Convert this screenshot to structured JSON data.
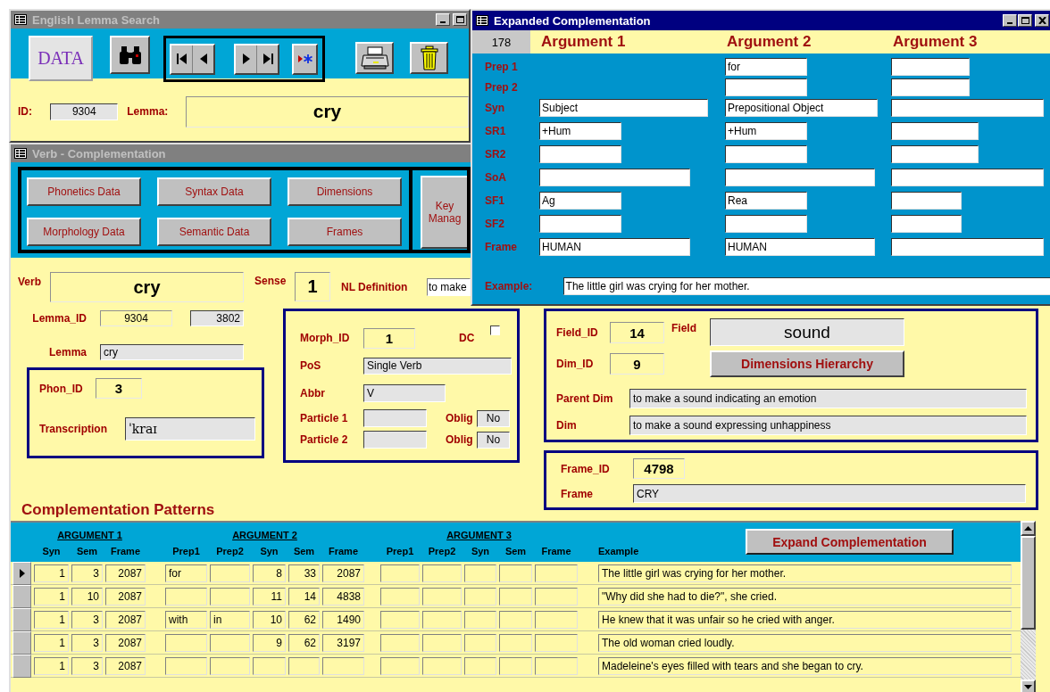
{
  "lemma_window": {
    "title": "English Lemma Search",
    "active": false,
    "data_button": "DATA",
    "id_label": "ID:",
    "id": "9304",
    "lemma_label": "Lemma:",
    "lemma": "cry"
  },
  "verb_window": {
    "title": "Verb - Complementation",
    "active": false,
    "buttons": [
      "Phonetics Data",
      "Syntax Data",
      "Dimensions",
      "Morphology Data",
      "Semantic Data",
      "Frames"
    ],
    "side_button": "Key Manag",
    "verb": {
      "label": "Verb",
      "value": "cry"
    },
    "sense": {
      "label": "Sense",
      "value": "1"
    },
    "nl_definition": {
      "label": "NL Definition",
      "value": "to make"
    },
    "lemma_id": {
      "label": "Lemma_ID",
      "value": "9304",
      "value_2": "3802"
    },
    "lemma": {
      "label": "Lemma",
      "value": "cry"
    },
    "phonetics": {
      "phon_id_label": "Phon_ID",
      "phon_id": "3",
      "transcription_label": "Transcription",
      "transcription": "ˈkraɪ"
    },
    "morphology": {
      "morph_id_label": "Morph_ID",
      "morph_id": "1",
      "dc_label": "DC",
      "dc": {
        "checked": false
      },
      "pos_label": "PoS",
      "pos": "Single Verb",
      "abbr_label": "Abbr",
      "abbr": "V",
      "particles": [
        {
          "label": "Particle 1",
          "oblig_label": "Oblig",
          "oblig": "No"
        },
        {
          "label": "Particle 2",
          "oblig_label": "Oblig",
          "oblig": "No"
        }
      ]
    },
    "dimensions": {
      "field_id_label": "Field_ID",
      "field_id": "14",
      "field_label": "Field",
      "field": "sound",
      "dim_id_label": "Dim_ID",
      "dim_id": "9",
      "hierarchy_button": "Dimensions Hierarchy",
      "parent_dim_label": "Parent Dim",
      "parent_dim": "to make a sound indicating an emotion",
      "dim_label": "Dim",
      "dim": "to make a sound expressing unhappiness"
    },
    "frame": {
      "frame_id_label": "Frame_ID",
      "frame_id": "4798",
      "frame_label": "Frame",
      "frame": "CRY"
    },
    "patterns": {
      "heading": "Complementation Patterns",
      "groups": [
        "ARGUMENT 1",
        "ARGUMENT 2",
        "ARGUMENT 3"
      ],
      "columns": [
        "Syn",
        "Sem",
        "Frame",
        "Prep1",
        "Prep2",
        "Syn",
        "Sem",
        "Frame",
        "Prep1",
        "Prep2",
        "Syn",
        "Sem",
        "Frame",
        "Example"
      ],
      "expand_button": "Expand Complementation",
      "rows": [
        {
          "selected": true,
          "arg1": {
            "syn": "1",
            "sem": "3",
            "frame": "2087"
          },
          "arg2": {
            "prep1": "for",
            "syn": "8",
            "sem": "33",
            "frame": "2087"
          },
          "example": "The little girl was crying for her mother."
        },
        {
          "selected": false,
          "arg1": {
            "syn": "1",
            "sem": "10",
            "frame": "2087"
          },
          "arg2": {
            "syn": "11",
            "sem": "14",
            "frame": "4838"
          },
          "example": "\"Why did she had to die?\", she cried."
        },
        {
          "selected": false,
          "arg1": {
            "syn": "1",
            "sem": "3",
            "frame": "2087"
          },
          "arg2": {
            "prep1": "with",
            "prep2": "in",
            "syn": "10",
            "sem": "62",
            "frame": "1490"
          },
          "example": "He knew that it was unfair so he cried with anger."
        },
        {
          "selected": false,
          "arg1": {
            "syn": "1",
            "sem": "3",
            "frame": "2087"
          },
          "arg2": {
            "syn": "9",
            "sem": "62",
            "frame": "3197"
          },
          "example": "The old woman cried loudly."
        },
        {
          "selected": false,
          "arg1": {
            "syn": "1",
            "sem": "3",
            "frame": "2087"
          },
          "example": "Madeleine's eyes filled with tears and she began to cry."
        }
      ]
    }
  },
  "expanded_window": {
    "title": "Expanded Complementation",
    "active": true,
    "record": "178",
    "arguments": [
      "Argument 1",
      "Argument 2",
      "Argument 3"
    ],
    "rows": [
      {
        "label": "Prep 1",
        "argument_2": "for"
      },
      {
        "label": "Prep 2"
      },
      {
        "label": "Syn",
        "argument_1": "Subject",
        "argument_2": "Prepositional Object"
      },
      {
        "label": "SR1",
        "argument_1": "+Hum",
        "argument_2": "+Hum"
      },
      {
        "label": "SR2"
      },
      {
        "label": "SoA"
      },
      {
        "label": "SF1",
        "argument_1": "Ag",
        "argument_2": "Rea"
      },
      {
        "label": "SF2"
      },
      {
        "label": "Frame",
        "argument_1": "HUMAN",
        "argument_2": "HUMAN"
      }
    ],
    "example_label": "Example:",
    "example": "The little girl was crying for her mother."
  }
}
